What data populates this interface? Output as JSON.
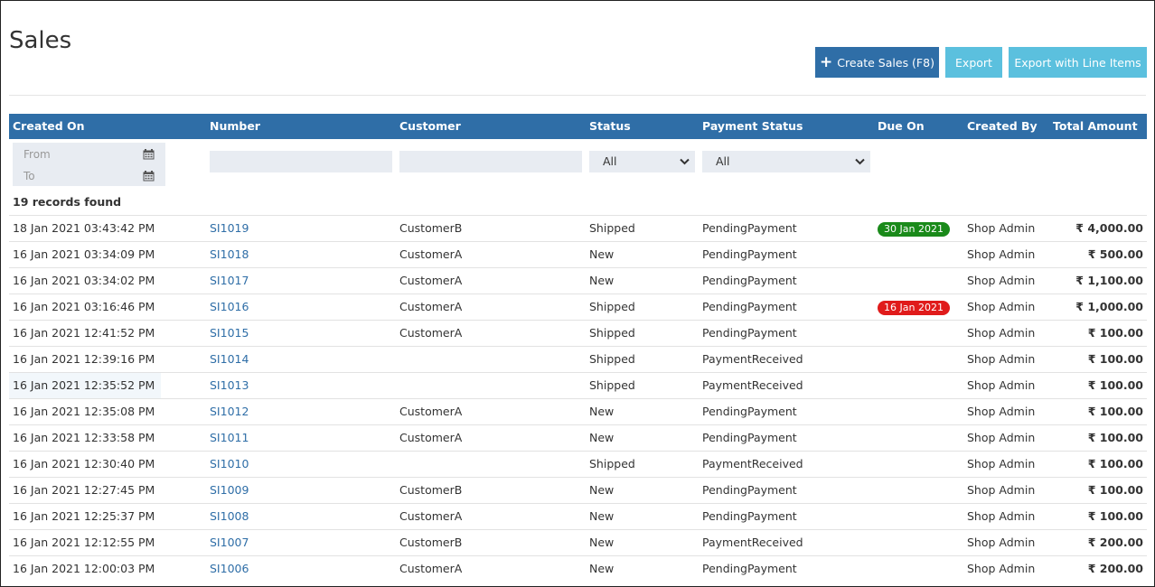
{
  "page": {
    "title": "Sales"
  },
  "toolbar": {
    "create_label": "Create Sales (F8)",
    "export_label": "Export",
    "export_lines_label": "Export with Line Items"
  },
  "columns": [
    "Created On",
    "Number",
    "Customer",
    "Status",
    "Payment Status",
    "Due On",
    "Created By",
    "Total Amount"
  ],
  "filters": {
    "from_label": "From",
    "to_label": "To",
    "status_value": "All",
    "payment_status_value": "All"
  },
  "records_found": "19 records found",
  "colors": {
    "header": "#2f6ea7",
    "due_green": "#1a8a1a",
    "due_red": "#e01b1b",
    "link": "#2f6ea7"
  },
  "rows": [
    {
      "created_on": "18 Jan 2021 03:43:42 PM",
      "number": "SI1019",
      "customer": "CustomerB",
      "status": "Shipped",
      "payment_status": "PendingPayment",
      "due_on": "30 Jan 2021",
      "due_color": "green",
      "created_by": "Shop Admin",
      "total": "₹ 4,000.00"
    },
    {
      "created_on": "16 Jan 2021 03:34:09 PM",
      "number": "SI1018",
      "customer": "CustomerA",
      "status": "New",
      "payment_status": "PendingPayment",
      "due_on": "",
      "created_by": "Shop Admin",
      "total": "₹ 500.00"
    },
    {
      "created_on": "16 Jan 2021 03:34:02 PM",
      "number": "SI1017",
      "customer": "CustomerA",
      "status": "New",
      "payment_status": "PendingPayment",
      "due_on": "",
      "created_by": "Shop Admin",
      "total": "₹ 1,100.00"
    },
    {
      "created_on": "16 Jan 2021 03:16:46 PM",
      "number": "SI1016",
      "customer": "CustomerA",
      "status": "Shipped",
      "payment_status": "PendingPayment",
      "due_on": "16 Jan 2021",
      "due_color": "red",
      "created_by": "Shop Admin",
      "total": "₹ 1,000.00"
    },
    {
      "created_on": "16 Jan 2021 12:41:52 PM",
      "number": "SI1015",
      "customer": "CustomerA",
      "status": "Shipped",
      "payment_status": "PendingPayment",
      "due_on": "",
      "created_by": "Shop Admin",
      "total": "₹ 100.00"
    },
    {
      "created_on": "16 Jan 2021 12:39:16 PM",
      "number": "SI1014",
      "customer": "",
      "status": "Shipped",
      "payment_status": "PaymentReceived",
      "due_on": "",
      "created_by": "Shop Admin",
      "total": "₹ 100.00"
    },
    {
      "created_on": "16 Jan 2021 12:35:52 PM",
      "number": "SI1013",
      "customer": "",
      "status": "Shipped",
      "payment_status": "PaymentReceived",
      "due_on": "",
      "created_by": "Shop Admin",
      "total": "₹ 100.00"
    },
    {
      "created_on": "16 Jan 2021 12:35:08 PM",
      "number": "SI1012",
      "customer": "CustomerA",
      "status": "New",
      "payment_status": "PendingPayment",
      "due_on": "",
      "created_by": "Shop Admin",
      "total": "₹ 100.00"
    },
    {
      "created_on": "16 Jan 2021 12:33:58 PM",
      "number": "SI1011",
      "customer": "CustomerA",
      "status": "New",
      "payment_status": "PendingPayment",
      "due_on": "",
      "created_by": "Shop Admin",
      "total": "₹ 100.00"
    },
    {
      "created_on": "16 Jan 2021 12:30:40 PM",
      "number": "SI1010",
      "customer": "",
      "status": "Shipped",
      "payment_status": "PaymentReceived",
      "due_on": "",
      "created_by": "Shop Admin",
      "total": "₹ 100.00"
    },
    {
      "created_on": "16 Jan 2021 12:27:45 PM",
      "number": "SI1009",
      "customer": "CustomerB",
      "status": "New",
      "payment_status": "PendingPayment",
      "due_on": "",
      "created_by": "Shop Admin",
      "total": "₹ 100.00"
    },
    {
      "created_on": "16 Jan 2021 12:25:37 PM",
      "number": "SI1008",
      "customer": "CustomerA",
      "status": "New",
      "payment_status": "PendingPayment",
      "due_on": "",
      "created_by": "Shop Admin",
      "total": "₹ 100.00"
    },
    {
      "created_on": "16 Jan 2021 12:12:55 PM",
      "number": "SI1007",
      "customer": "CustomerB",
      "status": "New",
      "payment_status": "PaymentReceived",
      "due_on": "",
      "created_by": "Shop Admin",
      "total": "₹ 200.00"
    },
    {
      "created_on": "16 Jan 2021 12:00:03 PM",
      "number": "SI1006",
      "customer": "CustomerA",
      "status": "New",
      "payment_status": "PendingPayment",
      "due_on": "",
      "created_by": "Shop Admin",
      "total": "₹ 200.00"
    }
  ]
}
